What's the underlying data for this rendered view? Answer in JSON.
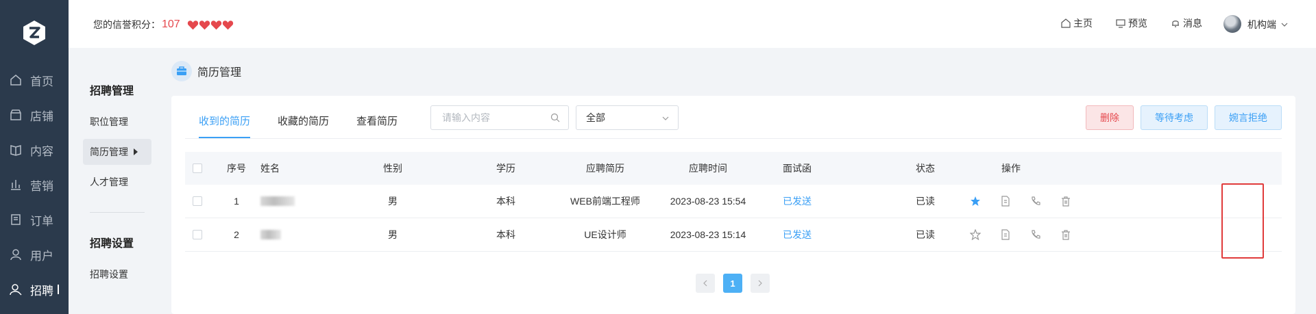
{
  "nav": {
    "items": [
      {
        "label": "首页",
        "icon": "home-icon"
      },
      {
        "label": "店铺",
        "icon": "store-icon"
      },
      {
        "label": "内容",
        "icon": "book-icon"
      },
      {
        "label": "营销",
        "icon": "chart-icon"
      },
      {
        "label": "订单",
        "icon": "order-icon"
      },
      {
        "label": "用户",
        "icon": "user-icon"
      },
      {
        "label": "招聘",
        "icon": "recruit-icon"
      }
    ],
    "active_index": 6
  },
  "header": {
    "credit_label": "您的信誉积分：",
    "credit_score": "107",
    "hearts": 4,
    "links": {
      "home": "主页",
      "preview": "预览",
      "messages": "消息"
    },
    "username": "机构端"
  },
  "subside": {
    "group1_title": "招聘管理",
    "items1": [
      "职位管理",
      "简历管理",
      "人才管理"
    ],
    "active_item": "简历管理",
    "group2_title": "招聘设置",
    "items2": [
      "招聘设置"
    ]
  },
  "page_title": "简历管理",
  "tabs": [
    "收到的简历",
    "收藏的简历",
    "查看简历"
  ],
  "active_tab": 0,
  "search": {
    "placeholder": "请输入内容"
  },
  "filter": {
    "selected": "全部"
  },
  "buttons": {
    "delete": "删除",
    "wait": "等待考虑",
    "reject": "婉言拒绝"
  },
  "table": {
    "headers": {
      "index": "序号",
      "name": "姓名",
      "gender": "性别",
      "edu": "学历",
      "resume": "应聘简历",
      "time": "应聘时间",
      "invite": "面试函",
      "status": "状态",
      "ops": "操作"
    },
    "rows": [
      {
        "index": "1",
        "gender": "男",
        "edu": "本科",
        "resume": "WEB前端工程师",
        "time": "2023-08-23 15:54",
        "invite": "已发送",
        "status": "已读",
        "starred": true
      },
      {
        "index": "2",
        "gender": "男",
        "edu": "本科",
        "resume": "UE设计师",
        "time": "2023-08-23 15:14",
        "invite": "已发送",
        "status": "已读",
        "starred": false
      }
    ]
  },
  "pager": {
    "current": "1"
  },
  "colors": {
    "accent": "#3a9ff5",
    "danger": "#e5484d",
    "nav_bg": "#2b3a4c"
  }
}
